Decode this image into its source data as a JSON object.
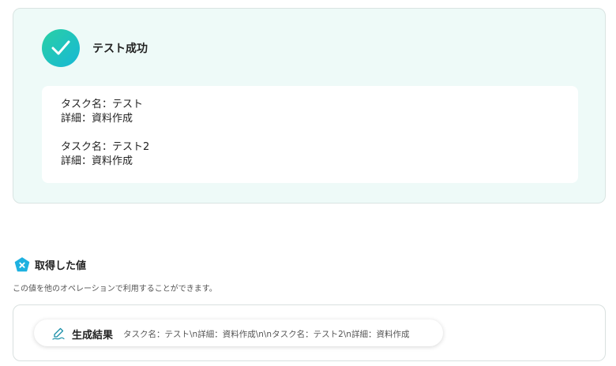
{
  "success": {
    "title": "テスト成功",
    "result_text": "タスク名：テスト\n詳細：資料作成\n\nタスク名：テスト2\n詳細：資料作成"
  },
  "acquired": {
    "title": "取得した値",
    "description": "この値を他のオペレーションで利用することができます。",
    "chip_label": "生成結果",
    "chip_value": "タスク名：テスト\\n詳細：資料作成\\n\\nタスク名：テスト2\\n詳細：資料作成"
  },
  "icons": {
    "success": "check-circle-icon",
    "section": "hexagon-x-icon",
    "chip": "pen-icon"
  },
  "colors": {
    "card_bg": "#eefaf8",
    "accent_start": "#2ad0a4",
    "accent_end": "#17b8d6",
    "section_icon": "#1eb1e0"
  }
}
